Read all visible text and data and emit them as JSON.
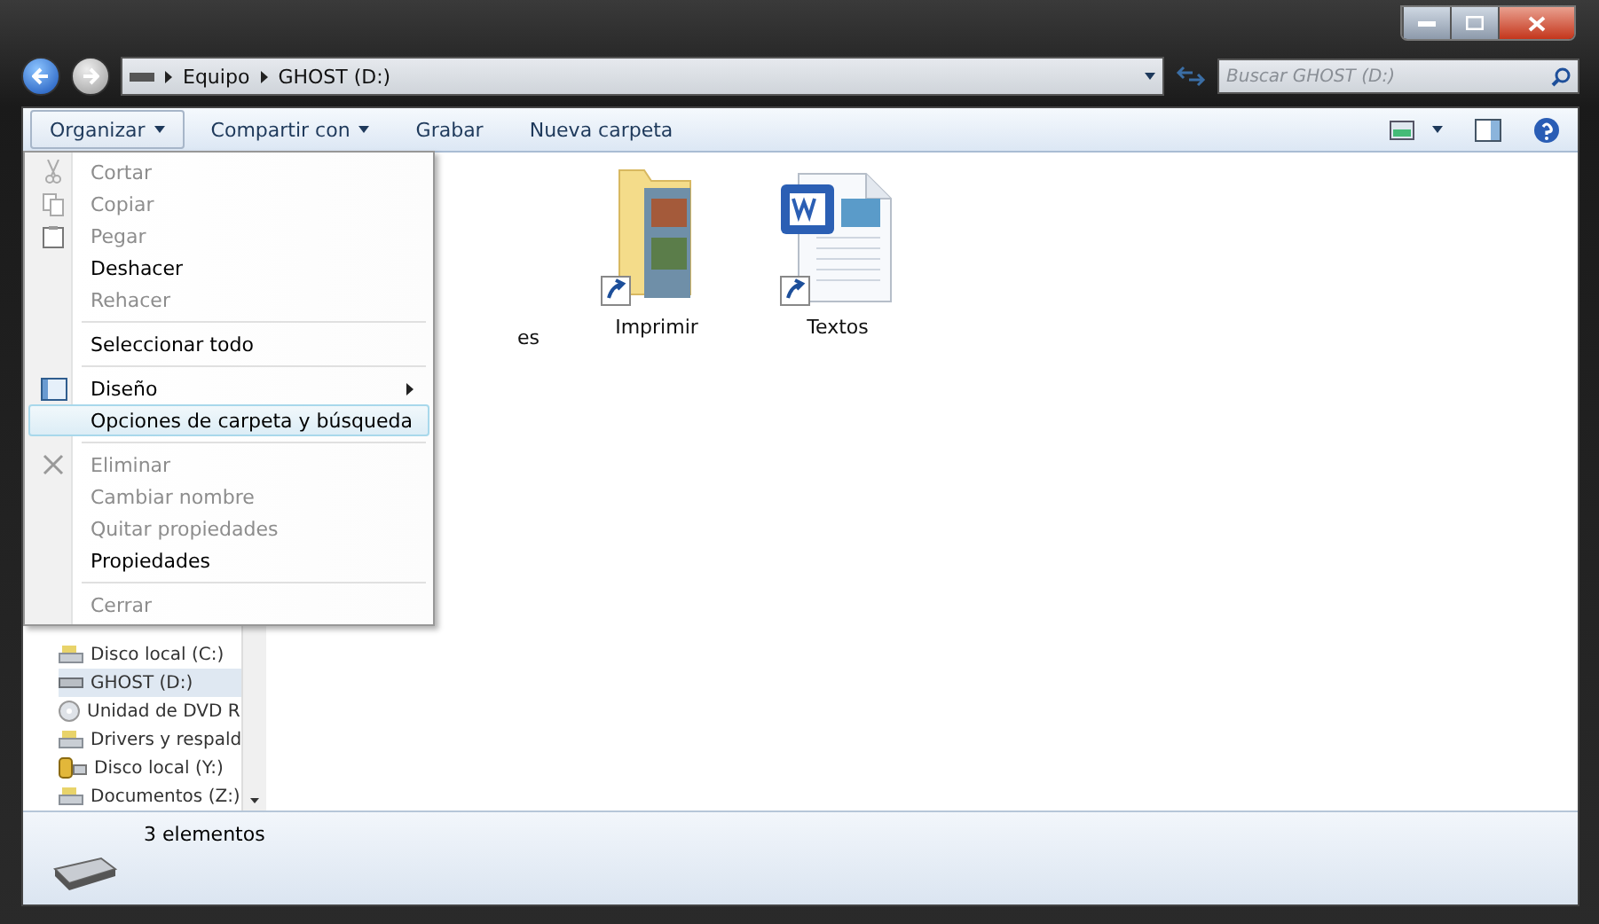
{
  "address": {
    "crumbs": [
      "Equipo",
      "GHOST (D:)"
    ]
  },
  "search": {
    "placeholder": "Buscar GHOST (D:)"
  },
  "toolbar": {
    "buttons": [
      {
        "label": "Organizar",
        "dropdown": true,
        "selected": true
      },
      {
        "label": "Compartir con",
        "dropdown": true,
        "selected": false
      },
      {
        "label": "Grabar",
        "dropdown": false,
        "selected": false
      },
      {
        "label": "Nueva carpeta",
        "dropdown": false,
        "selected": false
      }
    ]
  },
  "menu": {
    "groups": [
      [
        {
          "label": "Cortar",
          "disabled": true,
          "selected": false,
          "submenu": false
        },
        {
          "label": "Copiar",
          "disabled": true,
          "selected": false,
          "submenu": false
        },
        {
          "label": "Pegar",
          "disabled": true,
          "selected": false,
          "submenu": false
        },
        {
          "label": "Deshacer",
          "disabled": false,
          "selected": false,
          "submenu": false
        },
        {
          "label": "Rehacer",
          "disabled": true,
          "selected": false,
          "submenu": false
        }
      ],
      [
        {
          "label": "Seleccionar todo",
          "disabled": false,
          "selected": false,
          "submenu": false
        }
      ],
      [
        {
          "label": "Diseño",
          "disabled": false,
          "selected": false,
          "submenu": true
        },
        {
          "label": "Opciones de carpeta y búsqueda",
          "disabled": false,
          "selected": true,
          "submenu": false
        }
      ],
      [
        {
          "label": "Eliminar",
          "disabled": true,
          "selected": false,
          "submenu": false
        },
        {
          "label": "Cambiar nombre",
          "disabled": true,
          "selected": false,
          "submenu": false
        },
        {
          "label": "Quitar propiedades",
          "disabled": true,
          "selected": false,
          "submenu": false
        },
        {
          "label": "Propiedades",
          "disabled": false,
          "selected": false,
          "submenu": false
        }
      ],
      [
        {
          "label": "Cerrar",
          "disabled": true,
          "selected": false,
          "submenu": false
        }
      ]
    ]
  },
  "nav": {
    "items": [
      {
        "label": "Disco local (C:)",
        "selected": false
      },
      {
        "label": "GHOST (D:)",
        "selected": true
      },
      {
        "label": "Unidad de DVD R",
        "selected": false
      },
      {
        "label": "Drivers y respald",
        "selected": false
      },
      {
        "label": "Disco local (Y:)",
        "selected": false
      },
      {
        "label": "Documentos (Z:)",
        "selected": false
      }
    ]
  },
  "files": [
    {
      "label": "es",
      "kind": "hidden"
    },
    {
      "label": "Imprimir",
      "kind": "folder"
    },
    {
      "label": "Textos",
      "kind": "document"
    }
  ],
  "status_bar": {
    "count": "3 elementos"
  }
}
